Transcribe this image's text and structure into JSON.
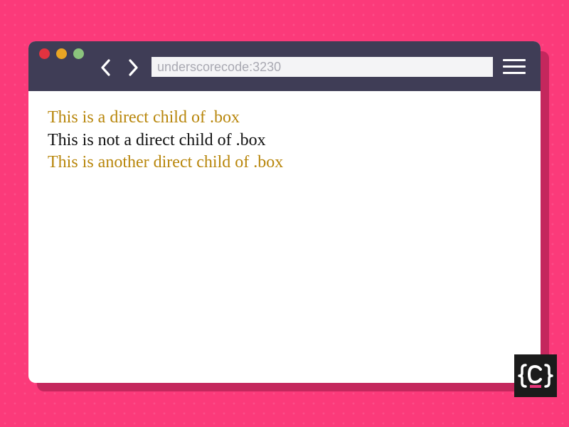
{
  "browser": {
    "address": "underscorecode:3230",
    "icons": {
      "back": "chevron-left-icon",
      "forward": "chevron-right-icon",
      "menu": "hamburger-menu-icon"
    }
  },
  "page": {
    "lines": [
      {
        "text": "This is a direct child of .box",
        "direct_child": true
      },
      {
        "text": "This is not a direct child of .box",
        "direct_child": false
      },
      {
        "text": "This is another direct child of .box",
        "direct_child": true
      }
    ]
  },
  "colors": {
    "background": "#fb3a7a",
    "toolbar": "#3f3d56",
    "direct_child_text": "#b8860b",
    "normal_text": "#111111",
    "traffic_red": "#e2333f",
    "traffic_yellow": "#e9a524",
    "traffic_green": "#8bc47d",
    "logo_accent": "#e8357a"
  },
  "logo": {
    "icon": "underscorecode-logo-icon"
  }
}
